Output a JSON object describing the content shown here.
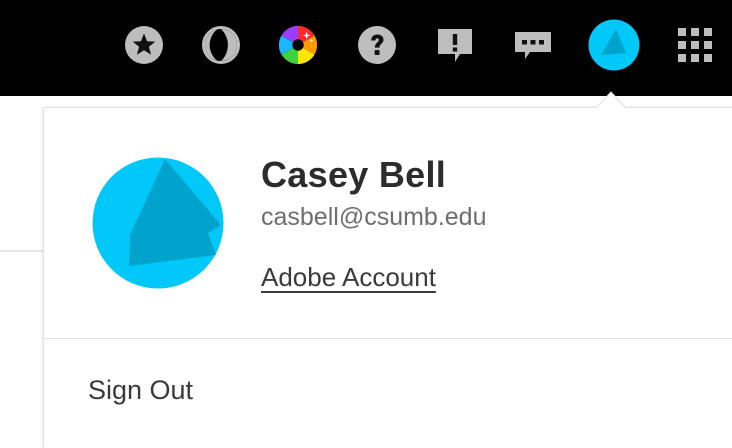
{
  "topbar": {
    "icons": [
      {
        "name": "favorites-star-icon"
      },
      {
        "name": "dark-mode-moon-icon"
      },
      {
        "name": "color-wheel-icon"
      },
      {
        "name": "help-icon"
      },
      {
        "name": "alert-feedback-icon"
      },
      {
        "name": "chat-messages-icon"
      },
      {
        "name": "user-avatar-icon"
      },
      {
        "name": "apps-grid-icon"
      }
    ],
    "colors": {
      "background": "#000000",
      "icon": "#bdbdbd",
      "avatar": "#00c8f8"
    }
  },
  "profile": {
    "name": "Casey Bell",
    "email": "casbell@csumb.edu",
    "account_link": "Adobe Account",
    "avatar_colors": {
      "light": "#00c8f8",
      "dark": "#00a3cc"
    }
  },
  "menu": {
    "sign_out": "Sign Out"
  }
}
